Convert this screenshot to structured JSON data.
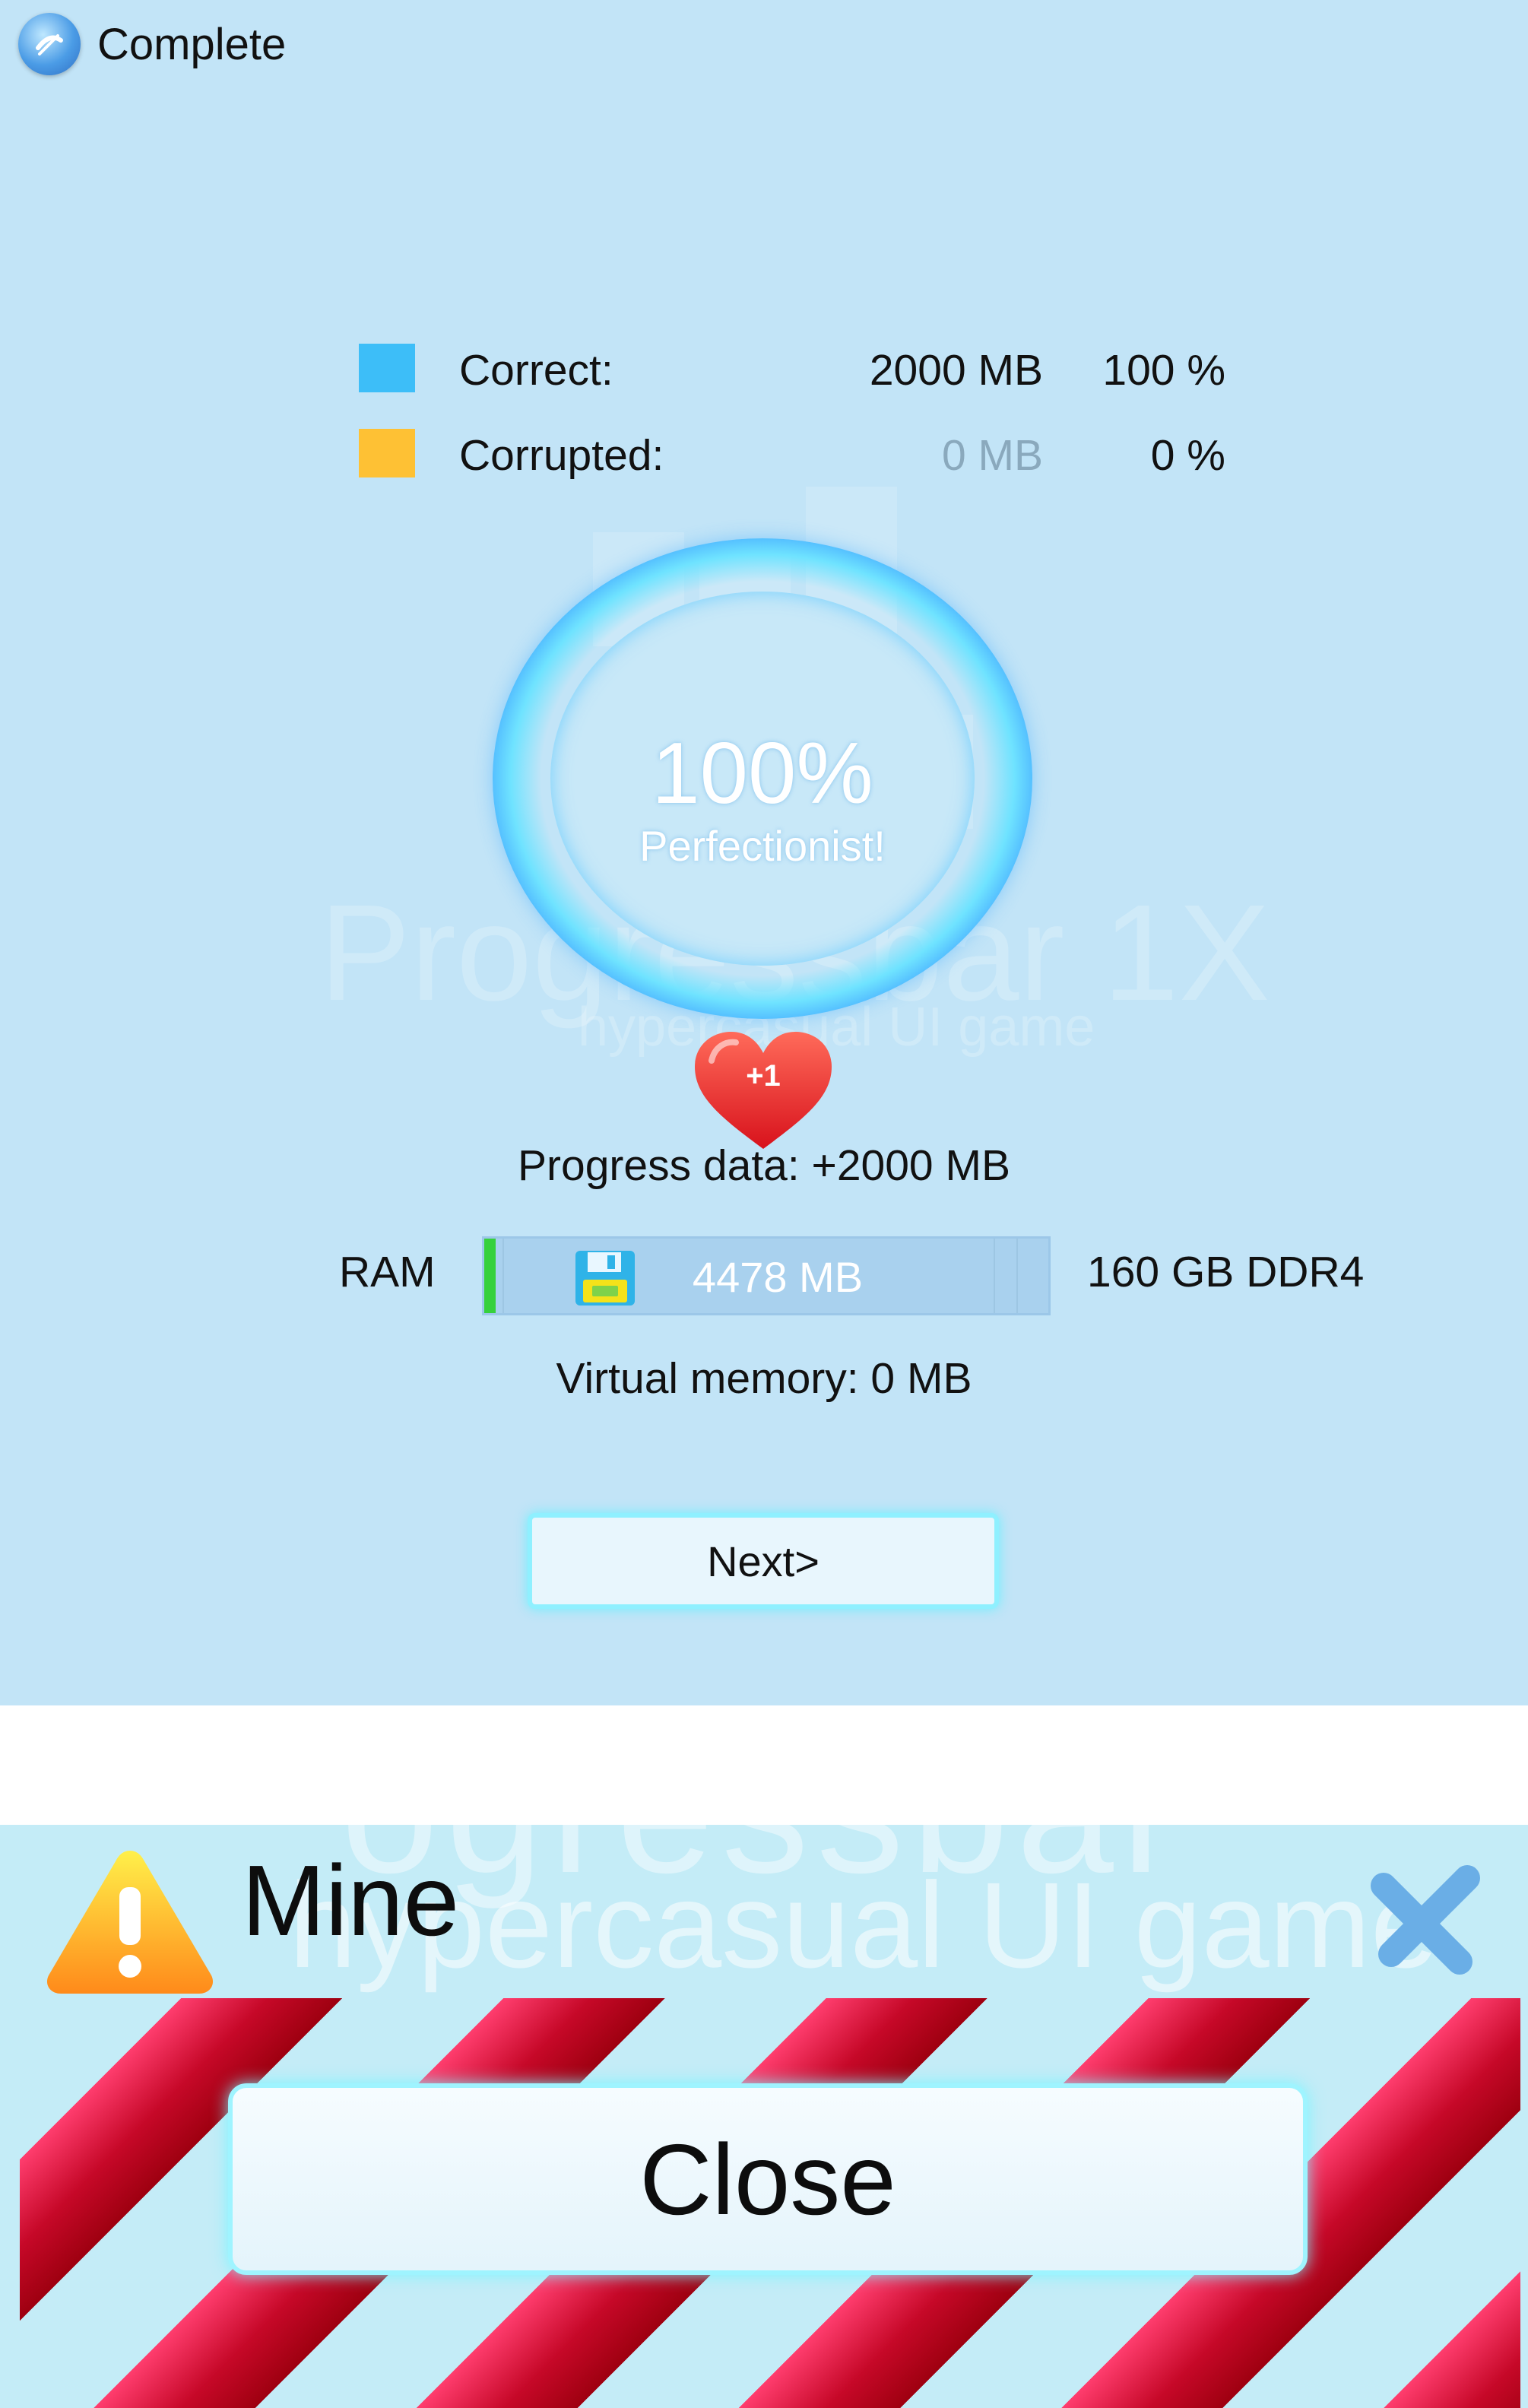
{
  "complete_window": {
    "title": "Complete",
    "watermark": {
      "main": "Progressbar 1X",
      "sub": "hypercasual UI game"
    },
    "legend": [
      {
        "label": "Correct:",
        "size": "2000 MB",
        "percent": "100 %",
        "color": "#3dbef8",
        "size_color": "#111111"
      },
      {
        "label": "Corrupted:",
        "size": "0 MB",
        "percent": "0 %",
        "color": "#fec134",
        "size_color": "#8aa9bd"
      }
    ],
    "ring": {
      "percent": "100%",
      "caption": "Perfectionist!"
    },
    "heart_badge": "+1",
    "progress_data": "Progress data: +2000 MB",
    "ram": {
      "label": "RAM",
      "value": "4478 MB",
      "total": "160 GB DDR4",
      "fill_fraction": 0.02
    },
    "virtual_memory": "Virtual memory: 0 MB",
    "next_button": "Next>"
  },
  "mine_window": {
    "title": "Mine",
    "watermark_top": "ogressbar",
    "watermark_sub": "hypercasual UI game",
    "close_button": "Close"
  },
  "colors": {
    "panel_background": "#c2e4f7",
    "ring_blue": "#2f7cf2",
    "ring_cyan": "#6fe3ff",
    "stripe_red": "#c60828",
    "button_glow": "#8ff0ff"
  }
}
